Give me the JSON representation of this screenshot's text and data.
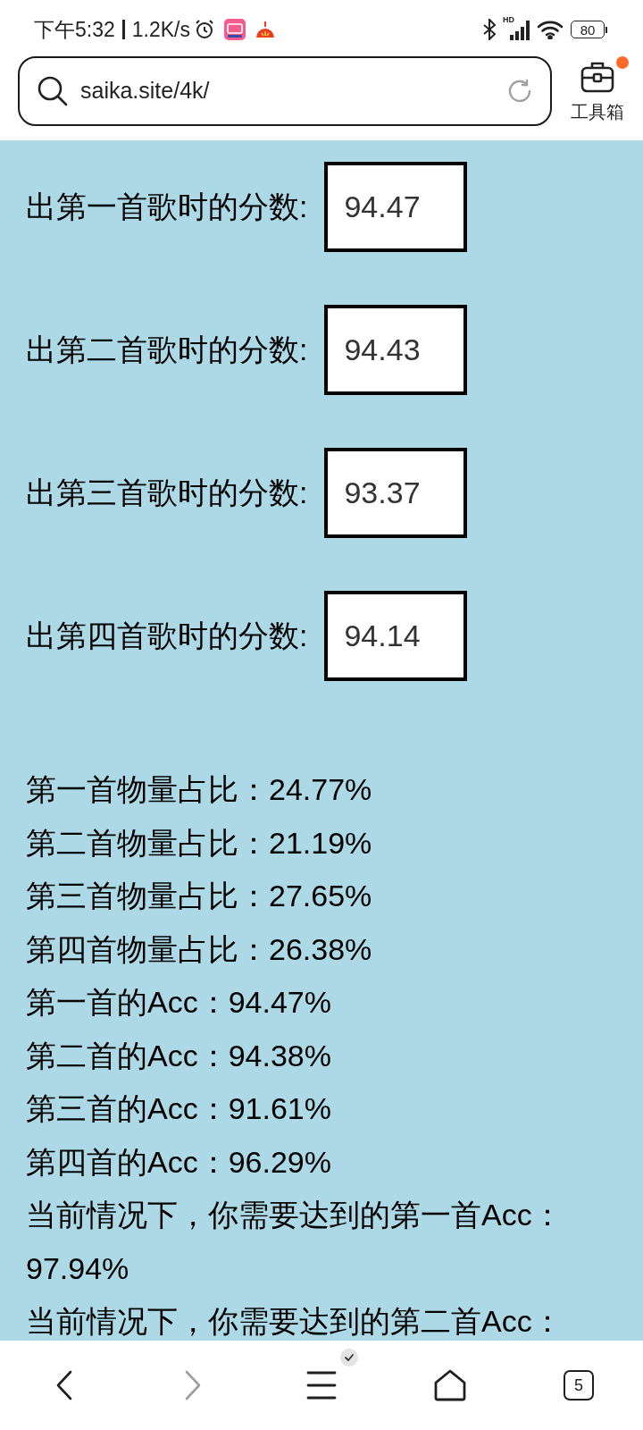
{
  "status_bar": {
    "time": "下午5:32",
    "network_speed": "1.2K/s",
    "network_type": "HD",
    "battery": "80"
  },
  "address_bar": {
    "url": "saika.site/4k/"
  },
  "toolbox": {
    "label": "工具箱",
    "notification": true
  },
  "score_fields": [
    {
      "label": "出第一首歌时的分数:",
      "value": "94.47"
    },
    {
      "label": "出第二首歌时的分数:",
      "value": "94.43"
    },
    {
      "label": "出第三首歌时的分数:",
      "value": "93.37"
    },
    {
      "label": "出第四首歌时的分数:",
      "value": "94.14"
    }
  ],
  "results": [
    "第一首物量占比：24.77%",
    "第二首物量占比：21.19%",
    "第三首物量占比：27.65%",
    "第四首物量占比：26.38%",
    "第一首的Acc：94.47%",
    "第二首的Acc：94.38%",
    "第三首的Acc：91.61%",
    "第四首的Acc：96.29%",
    "当前情况下，你需要达到的第一首Acc：97.94%",
    "当前情况下，你需要达到的第二首Acc："
  ],
  "bottom_nav": [
    {
      "kind": "back",
      "disabled": false,
      "badge": false
    },
    {
      "kind": "forward",
      "disabled": true,
      "badge": false
    },
    {
      "kind": "menu",
      "disabled": false,
      "badge": true
    },
    {
      "kind": "home",
      "disabled": false,
      "badge": false
    },
    {
      "kind": "tabs",
      "disabled": false,
      "badge": false,
      "count": "5"
    }
  ]
}
